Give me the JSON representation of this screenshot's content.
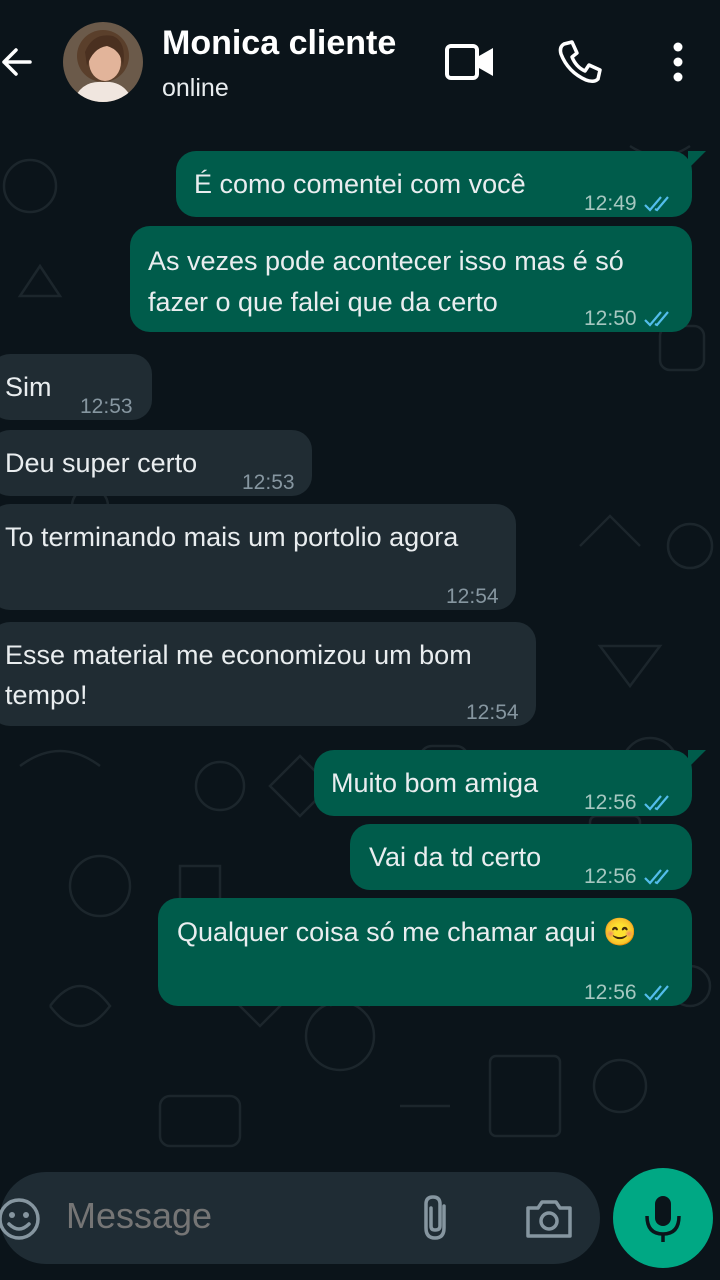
{
  "header": {
    "contact_name": "Monica cliente",
    "status": "online"
  },
  "messages": [
    {
      "direction": "out",
      "text_lines": [
        "É como comentei com você"
      ],
      "time": "12:49",
      "status": "read"
    },
    {
      "direction": "out",
      "text_lines": [
        "As vezes pode acontecer isso mas é só",
        "fazer o que falei que da certo"
      ],
      "time": "12:50",
      "status": "read"
    },
    {
      "direction": "in",
      "text_lines": [
        "Sim"
      ],
      "time": "12:53"
    },
    {
      "direction": "in",
      "text_lines": [
        "Deu super certo"
      ],
      "time": "12:53"
    },
    {
      "direction": "in",
      "text_lines": [
        "To terminando mais um portolio agora"
      ],
      "time": "12:54"
    },
    {
      "direction": "in",
      "text_lines": [
        "Esse material me economizou um bom",
        "tempo!"
      ],
      "time": "12:54"
    },
    {
      "direction": "out",
      "text_lines": [
        "Muito bom amiga"
      ],
      "time": "12:56",
      "status": "read"
    },
    {
      "direction": "out",
      "text_lines": [
        "Vai da td certo"
      ],
      "time": "12:56",
      "status": "read"
    },
    {
      "direction": "out",
      "text_lines": [
        "Qualquer coisa só me chamar aqui 😊"
      ],
      "time": "12:56",
      "status": "read"
    }
  ],
  "composer": {
    "placeholder": "Message"
  },
  "icons": {
    "back": "arrow-left-icon",
    "video_call": "video-camera-icon",
    "voice_call": "phone-icon",
    "menu": "more-vertical-icon",
    "emoji": "emoji-icon",
    "attach": "paperclip-icon",
    "camera": "camera-icon",
    "mic": "microphone-icon"
  },
  "colors": {
    "background": "#0b141a",
    "outgoing_bubble": "#005c4b",
    "incoming_bubble": "#202c33",
    "read_ticks": "#53bdeb",
    "mic_button": "#00a884"
  }
}
